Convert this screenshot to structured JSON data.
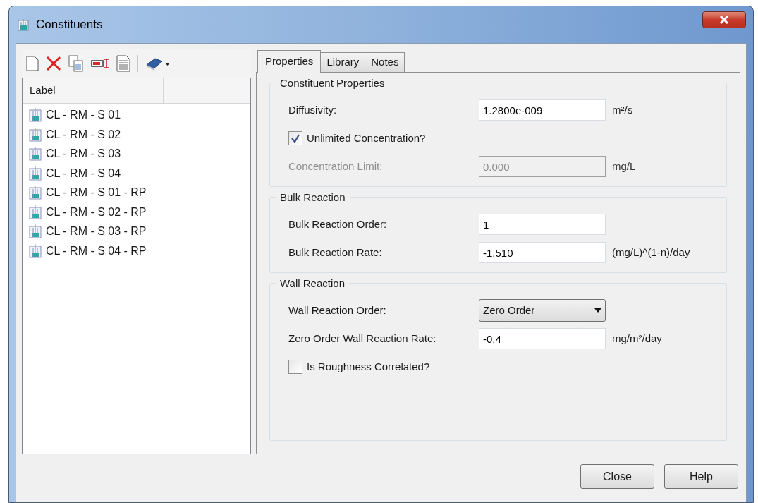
{
  "window": {
    "title": "Constituents"
  },
  "list": {
    "columns": [
      "Label"
    ],
    "items": [
      {
        "label": "CL - RM - S 01"
      },
      {
        "label": "CL - RM - S 02"
      },
      {
        "label": "CL - RM - S 03"
      },
      {
        "label": "CL - RM - S 04"
      },
      {
        "label": "CL - RM - S 01 - RP"
      },
      {
        "label": "CL - RM - S 02 - RP"
      },
      {
        "label": "CL - RM - S 03 - RP"
      },
      {
        "label": "CL - RM - S 04 - RP"
      }
    ]
  },
  "tabs": [
    {
      "label": "Properties",
      "selected": true
    },
    {
      "label": "Library",
      "selected": false
    },
    {
      "label": "Notes",
      "selected": false
    }
  ],
  "groups": [
    {
      "title": "Constituent Properties",
      "rows": [
        {
          "kind": "field",
          "label": "Diffusivity:",
          "value": "1.2800e-009",
          "unit": "m²/s",
          "disabled": false
        },
        {
          "kind": "checkbox",
          "label": "Unlimited Concentration?",
          "checked": true
        },
        {
          "kind": "field",
          "label": "Concentration Limit:",
          "value": "0.000",
          "unit": "mg/L",
          "disabled": true
        }
      ]
    },
    {
      "title": "Bulk Reaction",
      "rows": [
        {
          "kind": "field",
          "label": "Bulk Reaction Order:",
          "value": "1",
          "disabled": false
        },
        {
          "kind": "field",
          "label": "Bulk Reaction Rate:",
          "value": "-1.510",
          "unit": "(mg/L)^(1-n)/day",
          "disabled": false
        }
      ]
    },
    {
      "title": "Wall Reaction",
      "rows": [
        {
          "kind": "dropdown",
          "label": "Wall Reaction Order:",
          "value": "Zero Order"
        },
        {
          "kind": "field",
          "label": "Zero Order Wall Reaction Rate:",
          "value": "-0.4",
          "unit": "mg/m²/day",
          "disabled": false
        },
        {
          "kind": "checkbox",
          "label": "Is Roughness Correlated?",
          "checked": false
        }
      ]
    }
  ],
  "buttons": [
    "Close",
    "Help"
  ]
}
